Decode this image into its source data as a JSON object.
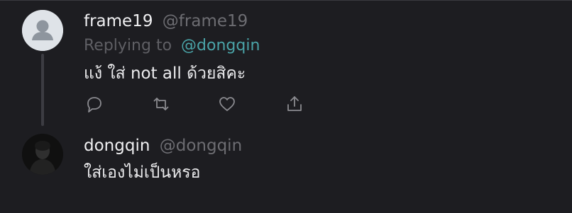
{
  "tweets": [
    {
      "display_name": "frame19",
      "handle": "@frame19",
      "replying_to_label": "Replying to",
      "replying_to_handle": "@dongqin",
      "text": "แง้ ใส่ not all ด้วยสิคะ",
      "avatar": "default-avatar-icon",
      "actions": [
        "reply-icon",
        "retweet-icon",
        "like-icon",
        "share-icon"
      ]
    },
    {
      "display_name": "dongqin",
      "handle": "@dongqin",
      "text": "ใส่เองไม่เป็นหรอ",
      "avatar": "user-photo"
    }
  ],
  "colors": {
    "background": "#1d1d21",
    "text": "#ececee",
    "muted": "#6d6d72",
    "mention": "#4aa4a8",
    "icon": "#8b8b90"
  }
}
